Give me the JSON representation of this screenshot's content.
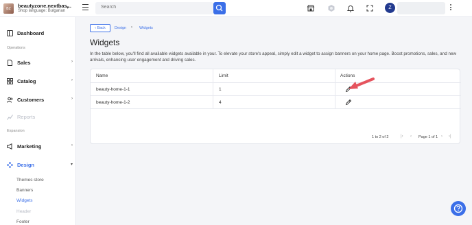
{
  "store": {
    "logo_text": "BZ",
    "name": "beautyzone.nextbas...",
    "language": "Shop language: Bulgarian"
  },
  "search": {
    "placeholder": "Search"
  },
  "user": {
    "avatar_letter": "Z"
  },
  "sidebar": {
    "dashboard": "Dashboard",
    "operations_label": "Operations",
    "sales": "Sales",
    "catalog": "Catalog",
    "customers": "Customers",
    "reports": "Reports",
    "expansion_label": "Expansion",
    "marketing": "Marketing",
    "design": "Design",
    "design_sub": [
      "Themes store",
      "Banners",
      "Widgets",
      "Header",
      "Footer"
    ]
  },
  "breadcrumb": {
    "back": "‹ Back",
    "design": "Design",
    "separator": "›",
    "widgets": "Widgets"
  },
  "page": {
    "title": "Widgets",
    "intro": "In the table below, you'll find all available widgets available in your. To elevate your store's appeal, simply edit a widget to assign banners on your home page. Boost promotions, sales, and new arrivals, enhancing user engagement and driving sales."
  },
  "table": {
    "headers": {
      "name": "Name",
      "limit": "Limit",
      "actions": "Actions"
    },
    "rows": [
      {
        "name": "beauty-home-1-1",
        "limit": "1"
      },
      {
        "name": "beauty-home-1-2",
        "limit": "4"
      }
    ],
    "pager": {
      "count": "1 to 2 of 2",
      "first": "|‹",
      "prev": "‹",
      "page": "Page 1 of 1",
      "next": "›",
      "last": "›|"
    }
  },
  "colors": {
    "accent": "#3b6fe8",
    "arrow": "#e5535d",
    "avatar": "#223a8f"
  }
}
